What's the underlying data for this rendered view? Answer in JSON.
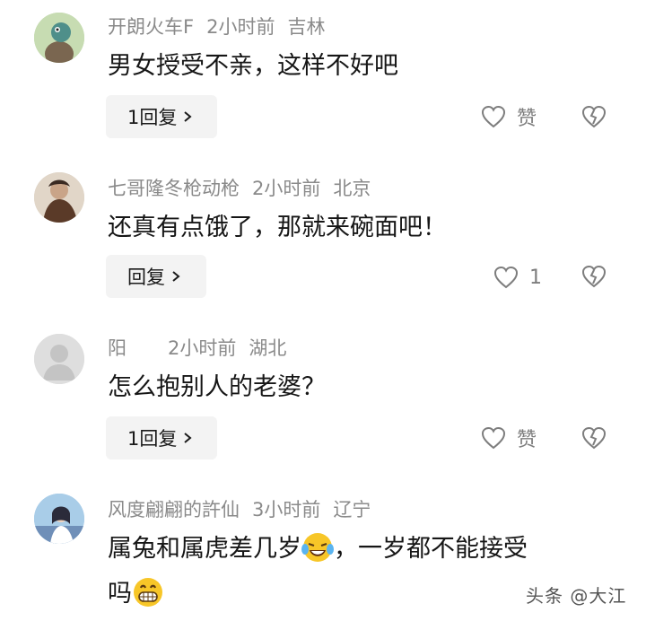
{
  "comments": [
    {
      "user": "开朗火车F",
      "time": "2小时前",
      "location": "吉林",
      "text": "男女授受不亲，这样不好吧",
      "reply_label": "1回复",
      "like_label": "赞",
      "avatar_icon": "green-creature-avatar"
    },
    {
      "user": "七哥隆冬枪动枪",
      "time": "2小时前",
      "location": "北京",
      "text": "还真有点饿了，那就来碗面吧！",
      "reply_label": "回复",
      "like_label": "1",
      "avatar_icon": "portrait-avatar"
    },
    {
      "user": "阳",
      "time": "2小时前",
      "location": "湖北",
      "text": "怎么抱别人的老婆？",
      "reply_label": "1回复",
      "like_label": "赞",
      "avatar_icon": "default-avatar"
    },
    {
      "user": "风度翩翩的許仙",
      "time": "3小时前",
      "location": "辽宁",
      "text_part1": "属兔和属虎差几岁",
      "text_part2": "，一岁都不能接受",
      "text_part3": "吗",
      "emoji1": "crying-laughing-emoji",
      "emoji2": "grinning-emoji",
      "avatar_icon": "anime-girl-avatar"
    }
  ],
  "watermark": "头条 @大江",
  "colors": {
    "meta": "#8a8a8a",
    "text": "#161616",
    "reply_bg": "#f3f3f3",
    "icon": "#7d7d7d"
  }
}
